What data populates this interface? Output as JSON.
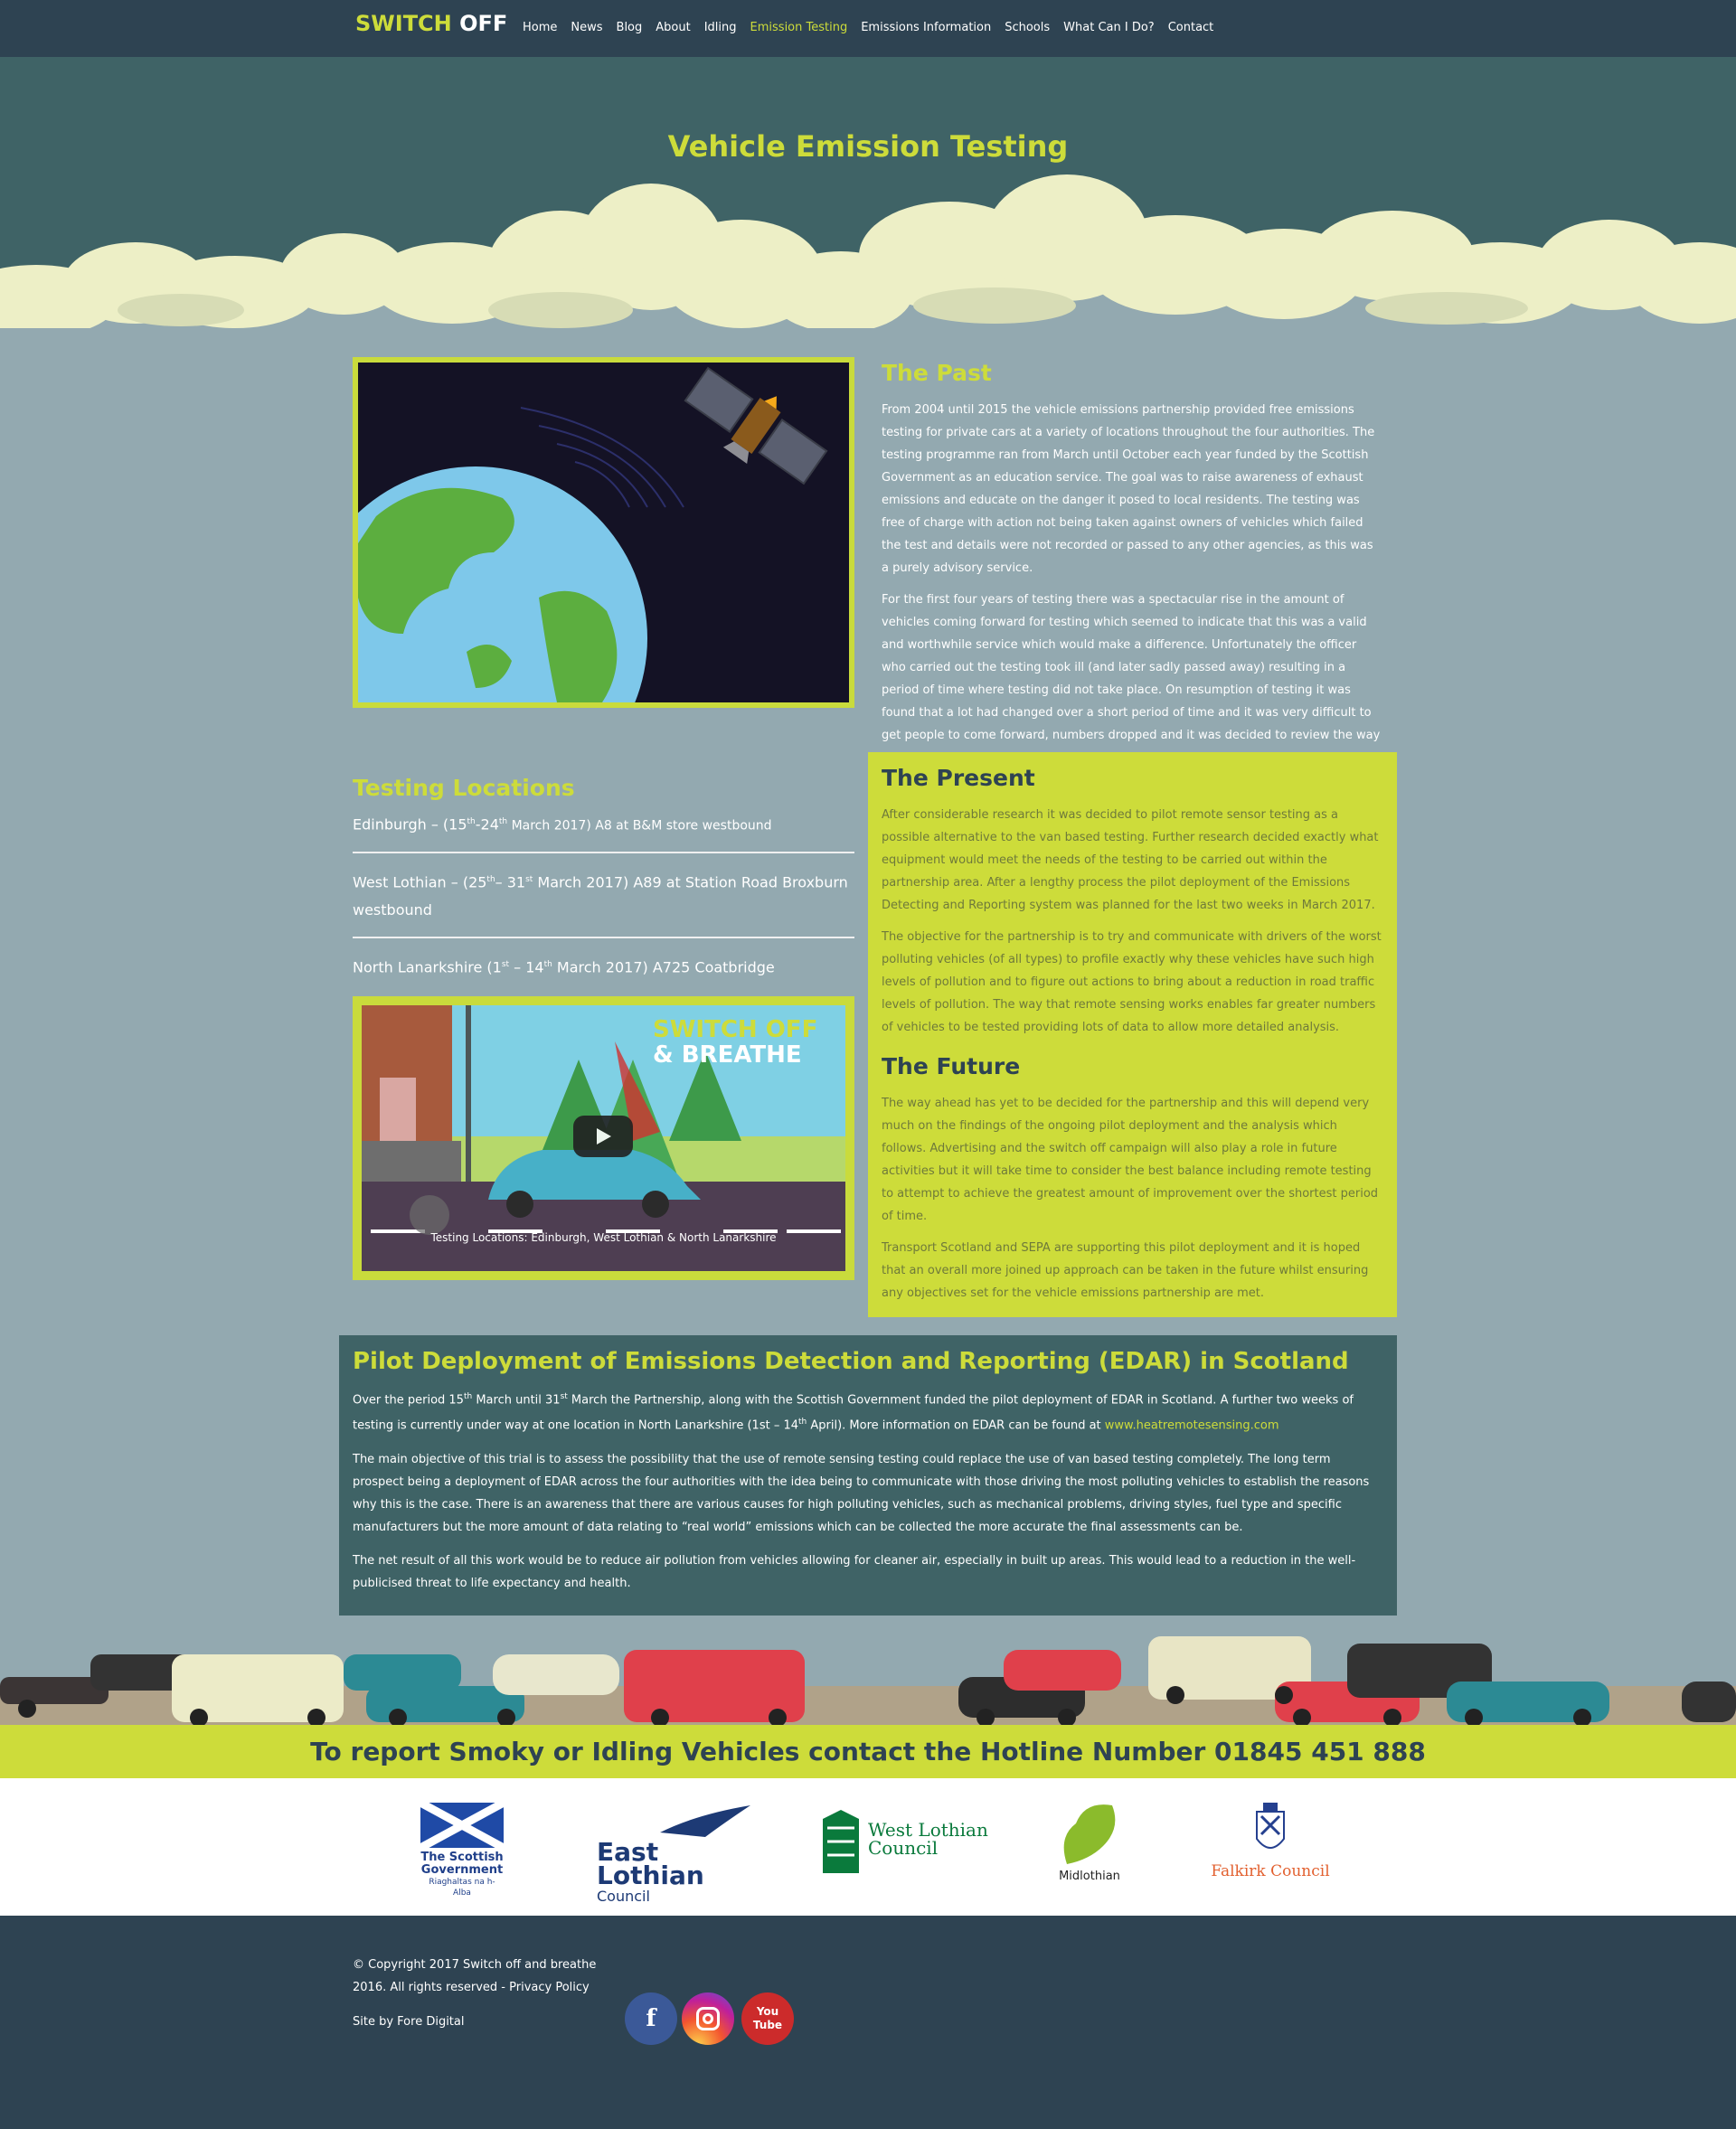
{
  "nav": {
    "logo_a": "SWITCH",
    "logo_b": "OFF",
    "items": [
      "Home",
      "News",
      "Blog",
      "About",
      "Idling",
      "Emission Testing",
      "Emissions Information",
      "Schools",
      "What Can I Do?",
      "Contact"
    ],
    "active": "Emission Testing"
  },
  "hero": {
    "title": "Vehicle Emission Testing"
  },
  "past": {
    "heading": "The Past",
    "p1": "From 2004 until 2015 the vehicle emissions partnership provided free emissions testing for private cars at a variety of locations throughout the four authorities. The testing programme ran from March until October each year funded by the Scottish Government as an education service. The goal was to raise awareness of exhaust emissions and educate on the danger it posed to local residents. The testing was free of charge with action not being taken against owners of vehicles which failed the test and details were not recorded or passed to any other agencies, as this was a purely advisory service.",
    "p2": "For the first four years of testing there was a spectacular rise in the amount of vehicles coming forward for testing which seemed to indicate that this was a valid and worthwhile service which would make a difference. Unfortunately the officer who carried out the testing took ill (and later sadly passed away) resulting in a period of time where testing did not take place. On resumption of testing it was found that a lot had changed over a short period of time and it was very difficult to get people to come forward, numbers dropped and it was decided to review the way that testing was carried out."
  },
  "locations": {
    "heading": "Testing Locations",
    "l1_a": "Edinburgh – (15",
    "l1_s1": "th",
    "l1_b": "-24",
    "l1_s2": "th",
    "l1_c": " March 2017) A8 at B&M store westbound",
    "l2_a": "West Lothian – (25",
    "l2_s1": "th",
    "l2_b": "– 31",
    "l2_s2": "st",
    "l2_c": " March 2017) A89 at Station Road Broxburn westbound",
    "l3_a": "North Lanarkshire (1",
    "l3_s1": "st",
    "l3_b": " – 14",
    "l3_s2": "th",
    "l3_c": " March 2017) A725 Coatbridge"
  },
  "video": {
    "title_a": "SWITCH OFF",
    "title_b": "& BREATHE",
    "caption": "Testing Locations: Edinburgh, West Lothian & North Lanarkshire"
  },
  "present": {
    "heading": "The Present",
    "p1": "After considerable research it was decided to pilot remote sensor testing as a possible alternative to the van based testing. Further research decided exactly what equipment would meet the needs of the testing to be carried out within the partnership area. After a lengthy process the pilot deployment of the Emissions Detecting and Reporting system was planned for the last two weeks in March 2017.",
    "p2": "The objective for the partnership is to try and communicate with drivers of the worst polluting vehicles (of all types) to profile exactly why these vehicles have such high levels of pollution and to figure out actions to bring about a reduction in road traffic levels of pollution. The way that remote sensing works enables far greater numbers of vehicles to be tested providing lots of data to allow more detailed analysis."
  },
  "future": {
    "heading": "The Future",
    "p1": "The way ahead has yet to be decided for the partnership and this will depend very much on the findings of the ongoing pilot deployment and the analysis which follows. Advertising and the switch off campaign will also play a role in future activities but it will take time to consider the best balance including remote testing to attempt to achieve the greatest amount of improvement over the shortest period of time.",
    "p2": "Transport Scotland and SEPA are supporting this pilot deployment and it is hoped that an overall more joined up approach can be taken in the future whilst ensuring any objectives set for the vehicle emissions partnership are met."
  },
  "edar": {
    "heading": "Pilot Deployment of Emissions Detection and Reporting (EDAR) in Scotland",
    "p1_a": "Over the period 15",
    "p1_s1": "th",
    "p1_b": " March until 31",
    "p1_s2": "st",
    "p1_c": " March the Partnership, along with the Scottish Government funded the pilot deployment of EDAR in Scotland. A further two weeks of testing is currently under way at one location in North Lanarkshire (1st – 14",
    "p1_s3": "th",
    "p1_d": " April). More information on EDAR can be found at ",
    "p1_link": "www.heatremotesensing.com",
    "p2": "The main objective of this trial is to assess the possibility that the use of remote sensing testing could replace the use of van based testing completely. The long term prospect being a deployment of EDAR across the four authorities with the idea being to communicate with those driving the most polluting vehicles to establish the reasons why this is the case. There is an awareness that there are various causes for high polluting vehicles, such as mechanical problems, driving styles, fuel type and specific manufacturers but the more amount of data relating to “real world” emissions which can be collected the more accurate the final assessments can be.",
    "p3": "The net result of all this work would be to reduce air pollution from vehicles allowing for cleaner air, especially in built up areas. This would lead to a reduction in the well-publicised threat to life expectancy and health."
  },
  "hotline": "To report Smoky or Idling Vehicles contact the Hotline Number 01845 451 888",
  "partners": {
    "scot_1": "The Scottish",
    "scot_2": "Government",
    "scot_3": "Riaghaltas na h-Alba",
    "el_1": "East Lothian",
    "el_2": "Council",
    "wl_1": "West Lothian",
    "wl_2": "Council",
    "mid": "Midlothian",
    "fal": "Falkirk Council"
  },
  "footer": {
    "copy1": "© Copyright 2017 Switch off and breathe",
    "copy2": "2016. All rights reserved - ",
    "privacy": "Privacy Policy",
    "site": "Site by Fore Digital",
    "social": [
      "f",
      "You Tube"
    ]
  },
  "colors": {
    "accent": "#cddc3a",
    "dark": "#2e4352",
    "teal": "#3f6366",
    "sky": "#93a9b0"
  }
}
